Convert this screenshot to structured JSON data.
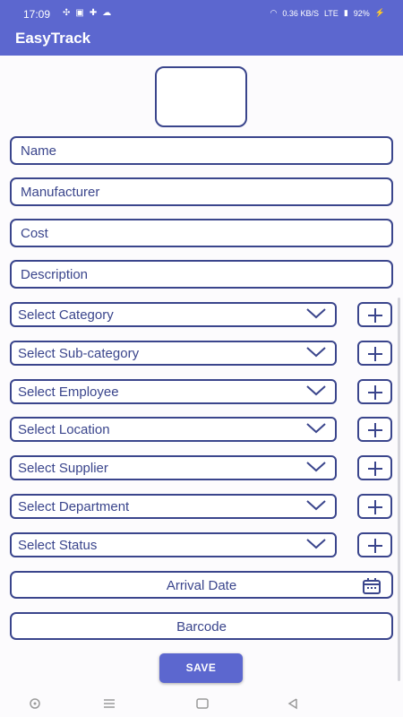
{
  "status": {
    "time": "17:09",
    "speed": "0.36",
    "speed_unit": "KB/S",
    "network": "LTE",
    "battery": "92%"
  },
  "app": {
    "title": "EasyTrack"
  },
  "form": {
    "name_placeholder": "Name",
    "manufacturer_placeholder": "Manufacturer",
    "cost_placeholder": "Cost",
    "description_placeholder": "Description",
    "selects": [
      {
        "label": "Select Category"
      },
      {
        "label": "Select Sub-category"
      },
      {
        "label": "Select Employee"
      },
      {
        "label": "Select Location"
      },
      {
        "label": "Select Supplier"
      },
      {
        "label": "Select Department"
      },
      {
        "label": "Select Status"
      }
    ],
    "arrival_date_label": "Arrival Date",
    "barcode_label": "Barcode",
    "save_label": "SAVE"
  },
  "colors": {
    "primary": "#5c67cf",
    "border": "#3a458c",
    "background": "#fcfbfd"
  },
  "icons": {
    "dropdown": "chevron-down-icon",
    "add": "plus-icon",
    "date": "calendar-icon"
  }
}
